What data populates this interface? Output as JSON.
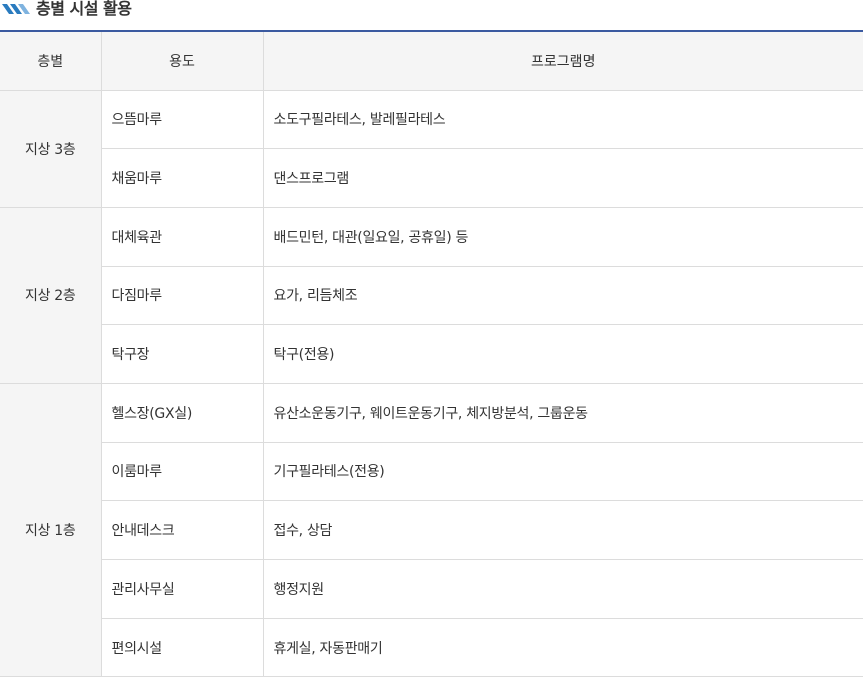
{
  "section": {
    "title": "층별 시설 활용",
    "icon": "double-slash-icon",
    "accent_color": "#2a7bbf"
  },
  "table": {
    "headers": [
      "층별",
      "용도",
      "프로그램명"
    ],
    "header_border_color": "#3b5aa0",
    "groups": [
      {
        "floor": "지상 3층",
        "rows": [
          {
            "use": "으뜸마루",
            "program": "소도구필라테스, 발레필라테스"
          },
          {
            "use": "채움마루",
            "program": "댄스프로그램"
          }
        ]
      },
      {
        "floor": "지상 2층",
        "rows": [
          {
            "use": "대체육관",
            "program": "배드민턴, 대관(일요일, 공휴일) 등"
          },
          {
            "use": "다짐마루",
            "program": "요가, 리듬체조"
          },
          {
            "use": "탁구장",
            "program": "탁구(전용)"
          }
        ]
      },
      {
        "floor": "지상 1층",
        "rows": [
          {
            "use": "헬스장(GX실)",
            "program": "유산소운동기구, 웨이트운동기구, 체지방분석, 그룹운동"
          },
          {
            "use": "이룸마루",
            "program": "기구필라테스(전용)"
          },
          {
            "use": "안내데스크",
            "program": "접수, 상담"
          },
          {
            "use": "관리사무실",
            "program": "행정지원"
          },
          {
            "use": "편의시설",
            "program": "휴게실, 자동판매기"
          }
        ]
      }
    ]
  }
}
